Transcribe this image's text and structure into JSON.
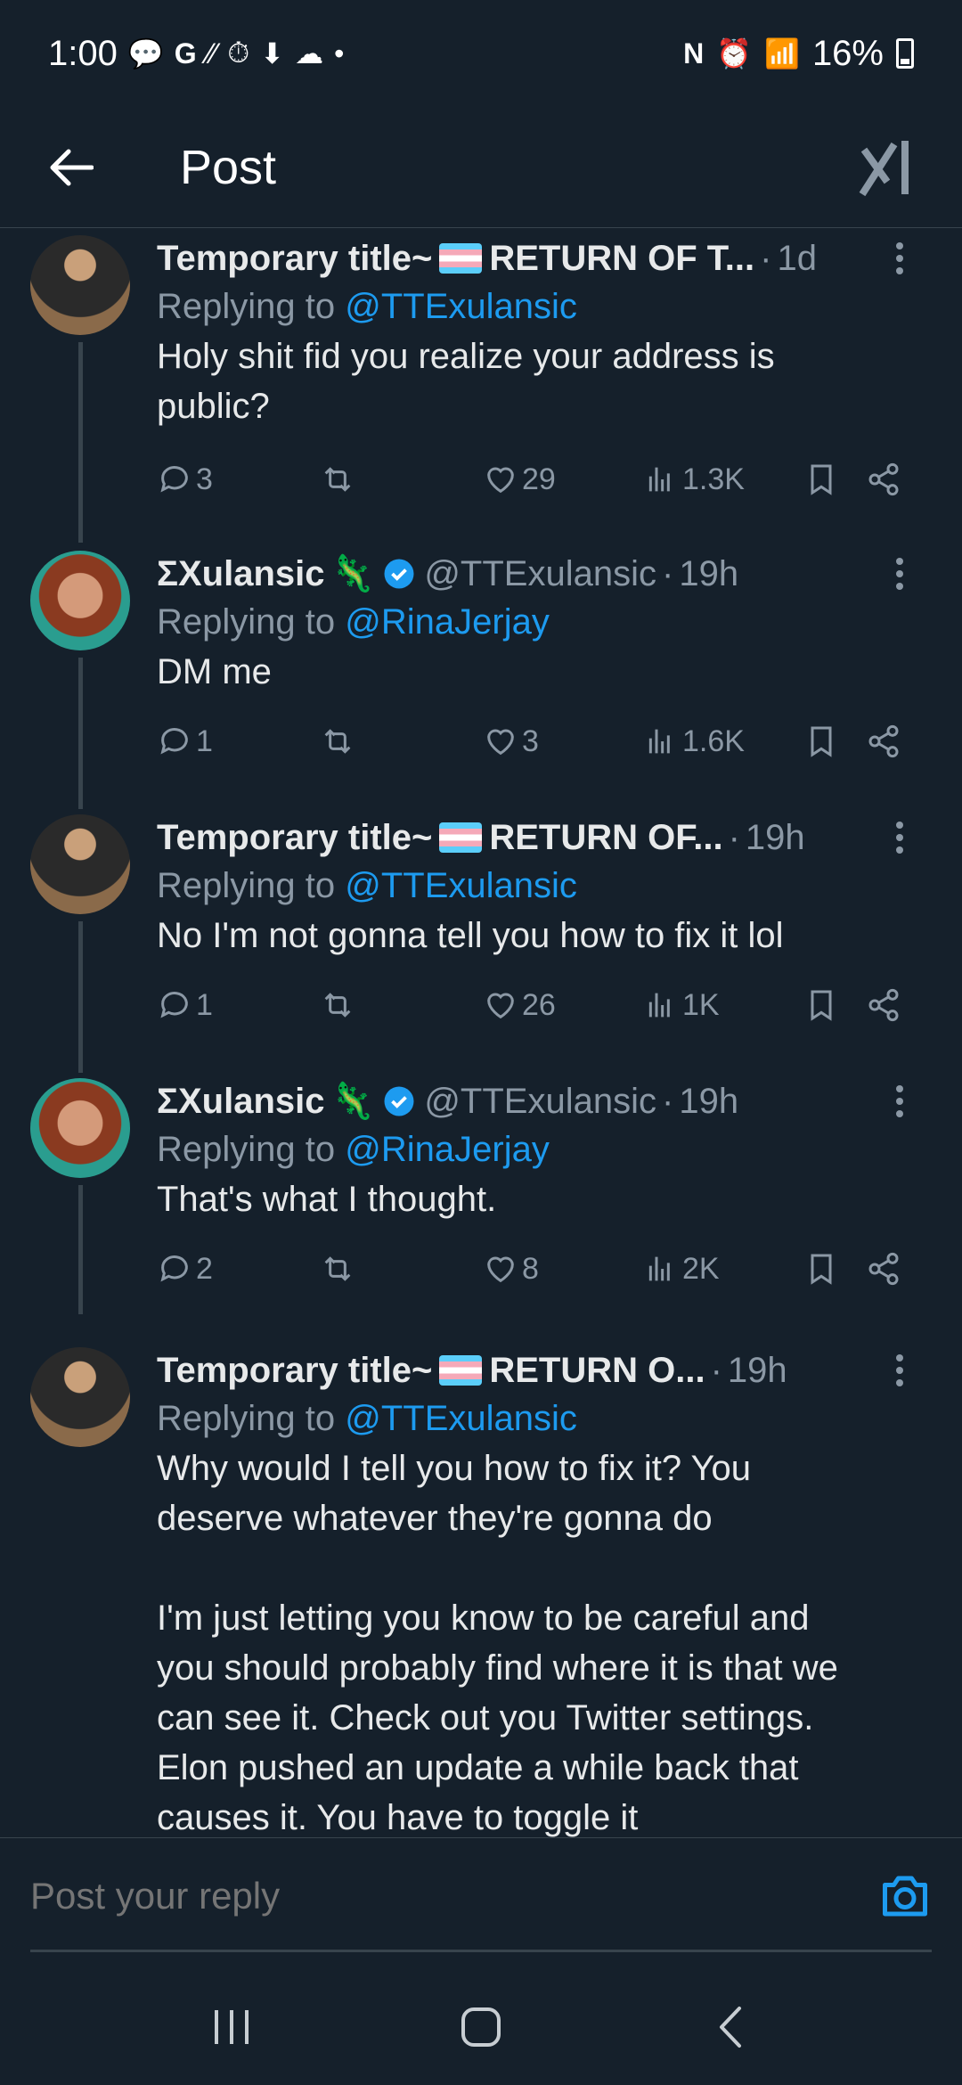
{
  "status_bar": {
    "time": "1:00",
    "battery": "16%"
  },
  "header": {
    "title": "Post"
  },
  "tweets": [
    {
      "name": "Temporary title~",
      "name_suffix": "RETURN OF T...",
      "handle": "",
      "time": "1d",
      "replying_label": "Replying to",
      "replying_to": "@TTExulansic",
      "text": "Holy shit fid you realize your address is\npublic?",
      "replies": "3",
      "likes": "29",
      "views": "1.3K"
    },
    {
      "name": "ΣXulansic",
      "name_suffix": "",
      "handle": "@TTExulansic",
      "time": "19h",
      "replying_label": "Replying to",
      "replying_to": "@RinaJerjay",
      "text": "DM me",
      "replies": "1",
      "likes": "3",
      "views": "1.6K"
    },
    {
      "name": "Temporary title~",
      "name_suffix": "RETURN OF...",
      "handle": "",
      "time": "19h",
      "replying_label": "Replying to",
      "replying_to": "@TTExulansic",
      "text": "No I'm not gonna tell you how to fix it lol",
      "replies": "1",
      "likes": "26",
      "views": "1K"
    },
    {
      "name": "ΣXulansic",
      "name_suffix": "",
      "handle": "@TTExulansic",
      "time": "19h",
      "replying_label": "Replying to",
      "replying_to": "@RinaJerjay",
      "text": "That's what I thought.",
      "replies": "2",
      "likes": "8",
      "views": "2K"
    },
    {
      "name": "Temporary title~",
      "name_suffix": "RETURN O...",
      "handle": "",
      "time": "19h",
      "replying_label": "Replying to",
      "replying_to": "@TTExulansic",
      "text": "Why would I tell you how to fix it? You\ndeserve whatever they're gonna do\n\nI'm just letting you know to be careful and\nyou should probably find where it is that we\ncan see it. Check out you Twitter settings.\nElon pushed an update a while back that\ncauses it. You have to toggle it",
      "replies": "",
      "likes": "",
      "views": ""
    }
  ],
  "reply_box": {
    "placeholder": "Post your reply"
  },
  "colors": {
    "background": "#15202b",
    "accent": "#1d9bf0",
    "muted": "#8b98a5",
    "divider": "#38444d"
  }
}
